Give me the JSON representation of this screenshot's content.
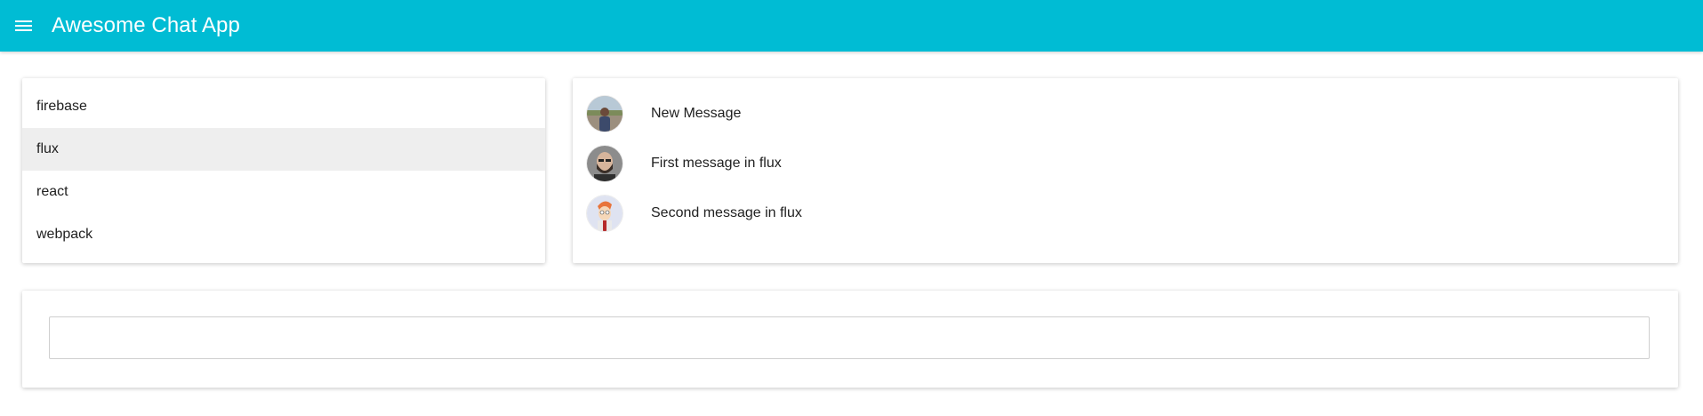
{
  "app": {
    "title": "Awesome Chat App",
    "accent_color": "#00bcd4",
    "menu_icon": "hamburger-menu-icon"
  },
  "channels": {
    "selected": "flux",
    "items": [
      {
        "label": "firebase"
      },
      {
        "label": "flux"
      },
      {
        "label": "react"
      },
      {
        "label": "webpack"
      }
    ]
  },
  "messages": {
    "items": [
      {
        "text": "New Message",
        "avatar": "user-avatar-landscape"
      },
      {
        "text": "First message in flux",
        "avatar": "user-avatar-bearded-man"
      },
      {
        "text": "Second message in flux",
        "avatar": "user-avatar-cartoon"
      }
    ]
  },
  "composer": {
    "value": "",
    "placeholder": ""
  }
}
